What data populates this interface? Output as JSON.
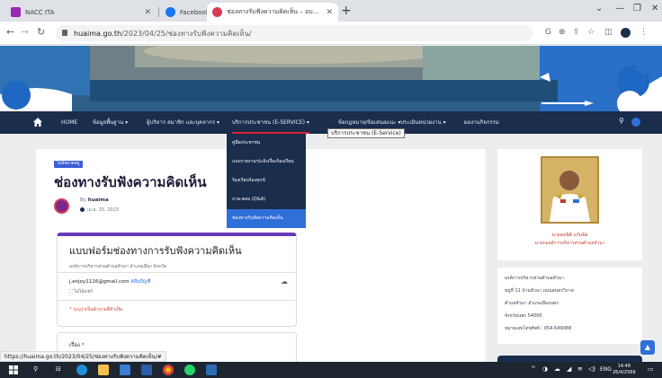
{
  "browser": {
    "tabs": [
      {
        "title": "NACC ITA",
        "active": false
      },
      {
        "title": "Facebook",
        "active": false
      },
      {
        "title": "ช่องทางรับฟังความคิดเห็น – อบต.หัวนา",
        "active": true
      }
    ],
    "new_tab_label": "+",
    "url_host": "huaima.go.th",
    "url_path": "/2023/04/25/ช่องทางรับฟังความคิดเห็น/"
  },
  "site": {
    "nav": {
      "home_label": "HOME",
      "items": [
        {
          "label": "ข้อมูลพื้นฐาน ▾"
        },
        {
          "label": "ผู้บริหาร สมาชิก และบุคลากร ▾"
        },
        {
          "label": "บริการประชาชน (E-SERVICE) ▾"
        },
        {
          "label": "ข้อกฎหมาย/ข้อเสนอแนะ ▾"
        },
        {
          "label": "ประเมินหน่วยงาน ▾"
        },
        {
          "label": "ผลงานกิจกรรม"
        }
      ]
    },
    "tooltip": "บริการประชาชน (E-Service)",
    "dropdown": [
      {
        "label": "คู่มือประชาชน",
        "active": false
      },
      {
        "label": "แบบรายงานฯ/แจ้งเรื่องร้องเรียน",
        "active": false
      },
      {
        "label": "ร้องเรียนร้องทุกข์",
        "active": false
      },
      {
        "label": "ถาม-ตอบ (Q&A)",
        "active": false
      },
      {
        "label": "ช่องทางรับฟังความคิดเห็น",
        "active": true
      }
    ]
  },
  "post": {
    "category": "ไม่มีหมวดหมู่",
    "title": "ช่องทางรับฟังความคิดเห็น",
    "by_label": "By",
    "author": "huaima",
    "date": "เม.ย. 25, 2023"
  },
  "form": {
    "title": "แบบฟอร์มช่องทางการรับฟังความคิดเห็น",
    "description": "องค์การบริหารส่วนตำบลหัวนา อำเภอเมือง จังหวัด",
    "email": "j.enjoy1116@gmail.com",
    "switch_account": "สลับบัญชี",
    "not_shared": "ไม่ได้แชร์",
    "required_note": "* ระบุว่าเป็นคำถามที่จำเป็น",
    "question": "เรื่อง",
    "required_mark": "*"
  },
  "sidebar": {
    "official_name": "นายคมนิติ แก้นนิย",
    "official_position": "นายกองค์การบริหารส่วนตำบลหัวนา",
    "address_lines": [
      "องค์การบริหารส่วนตำบลหัวนา",
      "หมู่ที่ 11 บ้านหัวนา ถนนสนทรวิถาส",
      "ตำบลหัวนา อำเภอเมืองนพร",
      "จังหวัดนพร 54000",
      "หมายเลขโทรศัพท์ : 054-649088"
    ]
  },
  "status_url": "https://huaima.go.th/2023/04/25/ช่องทางรับฟังความคิดเห็น/#",
  "taskbar": {
    "language": "ENG",
    "time": "14:48",
    "date": "26/4/2566"
  },
  "colors": {
    "nav_bg": "#1a2d4d",
    "active_item": "#2f6fd8",
    "form_accent": "#673ab7"
  }
}
